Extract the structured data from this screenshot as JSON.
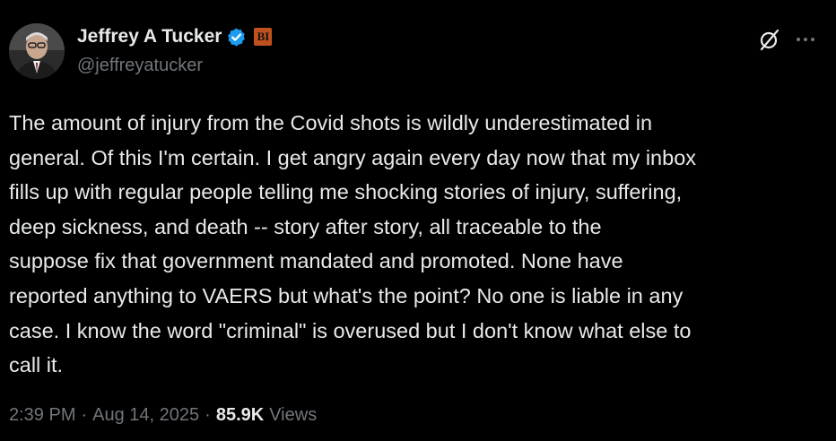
{
  "author": {
    "name": "Jeffrey A Tucker",
    "handle": "@jeffreyatucker",
    "verified_icon": "verified-badge-icon",
    "affiliate_badge": "BI",
    "affiliate_color": "#c0511f",
    "verified_color": "#1d9bf0"
  },
  "tweet": {
    "text": "The amount of injury from the Covid shots is wildly underestimated in\ngeneral. Of this I'm certain. I get angry again every day now that my inbox\nfills up with regular people telling me shocking stories of injury, suffering,\ndeep sickness, and death -- story after story, all traceable to the\nsuppose fix that government mandated and promoted. None have\nreported anything to VAERS but what's the point? No one is liable in any\ncase. I know the word \"criminal\" is overused but I don't know what else to\ncall it.",
    "time": "2:39 PM",
    "date": "Aug 14, 2025",
    "views_count": "85.9K",
    "views_label": "Views",
    "separator": "·"
  },
  "actions": {
    "grok_icon": "grok-icon",
    "more_icon": "more-options-icon"
  }
}
